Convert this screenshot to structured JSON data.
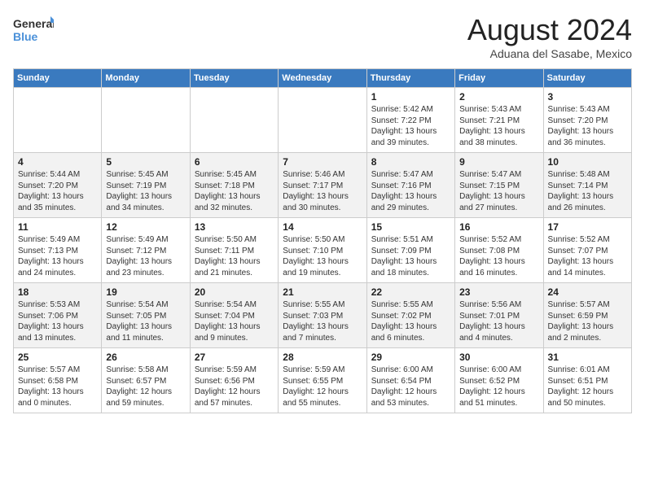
{
  "logo": {
    "line1": "General",
    "line2": "Blue"
  },
  "title": "August 2024",
  "location": "Aduana del Sasabe, Mexico",
  "weekdays": [
    "Sunday",
    "Monday",
    "Tuesday",
    "Wednesday",
    "Thursday",
    "Friday",
    "Saturday"
  ],
  "weeks": [
    [
      {
        "day": "",
        "info": ""
      },
      {
        "day": "",
        "info": ""
      },
      {
        "day": "",
        "info": ""
      },
      {
        "day": "",
        "info": ""
      },
      {
        "day": "1",
        "info": "Sunrise: 5:42 AM\nSunset: 7:22 PM\nDaylight: 13 hours\nand 39 minutes."
      },
      {
        "day": "2",
        "info": "Sunrise: 5:43 AM\nSunset: 7:21 PM\nDaylight: 13 hours\nand 38 minutes."
      },
      {
        "day": "3",
        "info": "Sunrise: 5:43 AM\nSunset: 7:20 PM\nDaylight: 13 hours\nand 36 minutes."
      }
    ],
    [
      {
        "day": "4",
        "info": "Sunrise: 5:44 AM\nSunset: 7:20 PM\nDaylight: 13 hours\nand 35 minutes."
      },
      {
        "day": "5",
        "info": "Sunrise: 5:45 AM\nSunset: 7:19 PM\nDaylight: 13 hours\nand 34 minutes."
      },
      {
        "day": "6",
        "info": "Sunrise: 5:45 AM\nSunset: 7:18 PM\nDaylight: 13 hours\nand 32 minutes."
      },
      {
        "day": "7",
        "info": "Sunrise: 5:46 AM\nSunset: 7:17 PM\nDaylight: 13 hours\nand 30 minutes."
      },
      {
        "day": "8",
        "info": "Sunrise: 5:47 AM\nSunset: 7:16 PM\nDaylight: 13 hours\nand 29 minutes."
      },
      {
        "day": "9",
        "info": "Sunrise: 5:47 AM\nSunset: 7:15 PM\nDaylight: 13 hours\nand 27 minutes."
      },
      {
        "day": "10",
        "info": "Sunrise: 5:48 AM\nSunset: 7:14 PM\nDaylight: 13 hours\nand 26 minutes."
      }
    ],
    [
      {
        "day": "11",
        "info": "Sunrise: 5:49 AM\nSunset: 7:13 PM\nDaylight: 13 hours\nand 24 minutes."
      },
      {
        "day": "12",
        "info": "Sunrise: 5:49 AM\nSunset: 7:12 PM\nDaylight: 13 hours\nand 23 minutes."
      },
      {
        "day": "13",
        "info": "Sunrise: 5:50 AM\nSunset: 7:11 PM\nDaylight: 13 hours\nand 21 minutes."
      },
      {
        "day": "14",
        "info": "Sunrise: 5:50 AM\nSunset: 7:10 PM\nDaylight: 13 hours\nand 19 minutes."
      },
      {
        "day": "15",
        "info": "Sunrise: 5:51 AM\nSunset: 7:09 PM\nDaylight: 13 hours\nand 18 minutes."
      },
      {
        "day": "16",
        "info": "Sunrise: 5:52 AM\nSunset: 7:08 PM\nDaylight: 13 hours\nand 16 minutes."
      },
      {
        "day": "17",
        "info": "Sunrise: 5:52 AM\nSunset: 7:07 PM\nDaylight: 13 hours\nand 14 minutes."
      }
    ],
    [
      {
        "day": "18",
        "info": "Sunrise: 5:53 AM\nSunset: 7:06 PM\nDaylight: 13 hours\nand 13 minutes."
      },
      {
        "day": "19",
        "info": "Sunrise: 5:54 AM\nSunset: 7:05 PM\nDaylight: 13 hours\nand 11 minutes."
      },
      {
        "day": "20",
        "info": "Sunrise: 5:54 AM\nSunset: 7:04 PM\nDaylight: 13 hours\nand 9 minutes."
      },
      {
        "day": "21",
        "info": "Sunrise: 5:55 AM\nSunset: 7:03 PM\nDaylight: 13 hours\nand 7 minutes."
      },
      {
        "day": "22",
        "info": "Sunrise: 5:55 AM\nSunset: 7:02 PM\nDaylight: 13 hours\nand 6 minutes."
      },
      {
        "day": "23",
        "info": "Sunrise: 5:56 AM\nSunset: 7:01 PM\nDaylight: 13 hours\nand 4 minutes."
      },
      {
        "day": "24",
        "info": "Sunrise: 5:57 AM\nSunset: 6:59 PM\nDaylight: 13 hours\nand 2 minutes."
      }
    ],
    [
      {
        "day": "25",
        "info": "Sunrise: 5:57 AM\nSunset: 6:58 PM\nDaylight: 13 hours\nand 0 minutes."
      },
      {
        "day": "26",
        "info": "Sunrise: 5:58 AM\nSunset: 6:57 PM\nDaylight: 12 hours\nand 59 minutes."
      },
      {
        "day": "27",
        "info": "Sunrise: 5:59 AM\nSunset: 6:56 PM\nDaylight: 12 hours\nand 57 minutes."
      },
      {
        "day": "28",
        "info": "Sunrise: 5:59 AM\nSunset: 6:55 PM\nDaylight: 12 hours\nand 55 minutes."
      },
      {
        "day": "29",
        "info": "Sunrise: 6:00 AM\nSunset: 6:54 PM\nDaylight: 12 hours\nand 53 minutes."
      },
      {
        "day": "30",
        "info": "Sunrise: 6:00 AM\nSunset: 6:52 PM\nDaylight: 12 hours\nand 51 minutes."
      },
      {
        "day": "31",
        "info": "Sunrise: 6:01 AM\nSunset: 6:51 PM\nDaylight: 12 hours\nand 50 minutes."
      }
    ]
  ]
}
